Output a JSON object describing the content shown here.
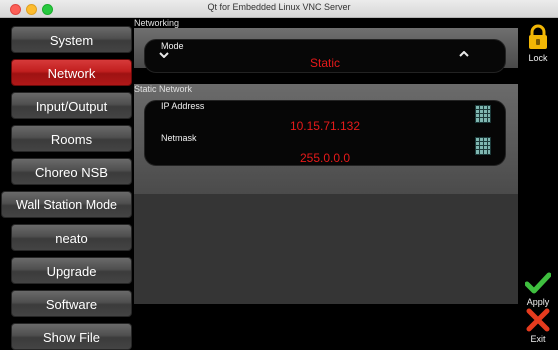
{
  "window": {
    "title": "Qt for Embedded Linux VNC Server"
  },
  "nav": {
    "items": [
      {
        "label": "System",
        "active": false
      },
      {
        "label": "Network",
        "active": true
      },
      {
        "label": "Input/Output",
        "active": false
      },
      {
        "label": "Rooms",
        "active": false
      },
      {
        "label": "Choreo NSB",
        "active": false
      },
      {
        "label": "Wall Station Mode",
        "active": false
      },
      {
        "label": "neato",
        "active": false
      },
      {
        "label": "Upgrade",
        "active": false
      },
      {
        "label": "Software",
        "active": false
      },
      {
        "label": "Show File",
        "active": false
      }
    ]
  },
  "networking": {
    "section_label": "Networking",
    "mode_label": "Mode",
    "mode_value": "Static"
  },
  "static_network": {
    "section_label": "Static Network",
    "ip_label": "IP Address",
    "ip_value": "10.15.71.132",
    "netmask_label": "Netmask",
    "netmask_value": "255.0.0.0"
  },
  "right": {
    "lock_label": "Lock",
    "apply_label": "Apply",
    "exit_label": "Exit"
  },
  "colors": {
    "accent_red": "#e61a1a",
    "active_nav": "#c21f1f",
    "lock_yellow": "#f2b705",
    "apply_green": "#3fbf3f",
    "exit_red": "#e63b1e"
  }
}
